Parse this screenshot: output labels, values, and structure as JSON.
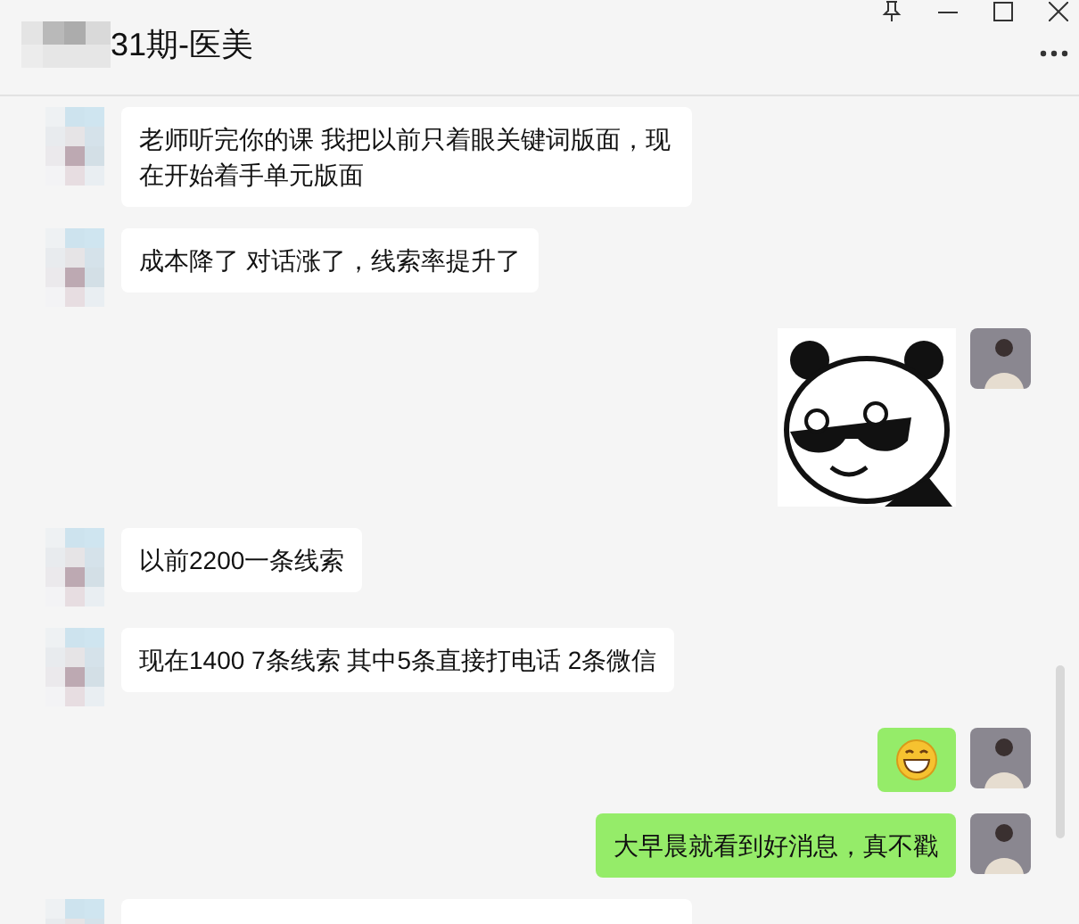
{
  "header": {
    "title": "31期-医美"
  },
  "messages": [
    {
      "kind": "text",
      "outgoing": false,
      "text": "老师听完你的课 我把以前只着眼关键词版面，现在开始着手单元版面"
    },
    {
      "kind": "text",
      "outgoing": false,
      "text": "成本降了 对话涨了，线索率提升了"
    },
    {
      "kind": "sticker",
      "outgoing": true
    },
    {
      "kind": "text",
      "outgoing": false,
      "text": "以前2200一条线索"
    },
    {
      "kind": "text",
      "outgoing": false,
      "text": "现在1400  7条线索 其中5条直接打电话 2条微信"
    },
    {
      "kind": "emoji",
      "outgoing": true
    },
    {
      "kind": "text",
      "outgoing": true,
      "text": "大早晨就看到好消息，真不戳"
    },
    {
      "kind": "cutoff",
      "outgoing": false
    }
  ]
}
